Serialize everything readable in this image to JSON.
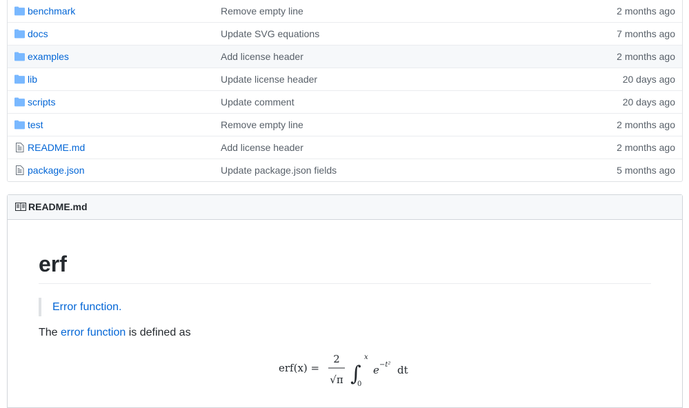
{
  "files": [
    {
      "name": "benchmark",
      "type": "folder",
      "message": "Remove empty line",
      "age": "2 months ago"
    },
    {
      "name": "docs",
      "type": "folder",
      "message": "Update SVG equations",
      "age": "7 months ago"
    },
    {
      "name": "examples",
      "type": "folder",
      "message": "Add license header",
      "age": "2 months ago"
    },
    {
      "name": "lib",
      "type": "folder",
      "message": "Update license header",
      "age": "20 days ago"
    },
    {
      "name": "scripts",
      "type": "folder",
      "message": "Update comment",
      "age": "20 days ago"
    },
    {
      "name": "test",
      "type": "folder",
      "message": "Remove empty line",
      "age": "2 months ago"
    },
    {
      "name": "README.md",
      "type": "file",
      "message": "Add license header",
      "age": "2 months ago"
    },
    {
      "name": "package.json",
      "type": "file",
      "message": "Update package.json fields",
      "age": "5 months ago"
    }
  ],
  "readme": {
    "header_title": "README.md",
    "h1": "erf",
    "quote_link": "Error function.",
    "para_before": "The ",
    "para_link": "error function",
    "para_after": " is defined as",
    "equation": {
      "lhs": "erf(x) =",
      "numerator": "2",
      "denominator": "√π",
      "integral_upper": "x",
      "integral_lower": "0",
      "integrand": "e",
      "exponent": "−t²",
      "differential": "dt"
    }
  },
  "colors": {
    "link": "#0366d6",
    "muted": "#586069",
    "icon": "#79b8ff",
    "file_icon": "#6a737d"
  },
  "icons": {
    "folder": "folder-icon",
    "file": "file-text-icon",
    "readme": "book-icon"
  }
}
